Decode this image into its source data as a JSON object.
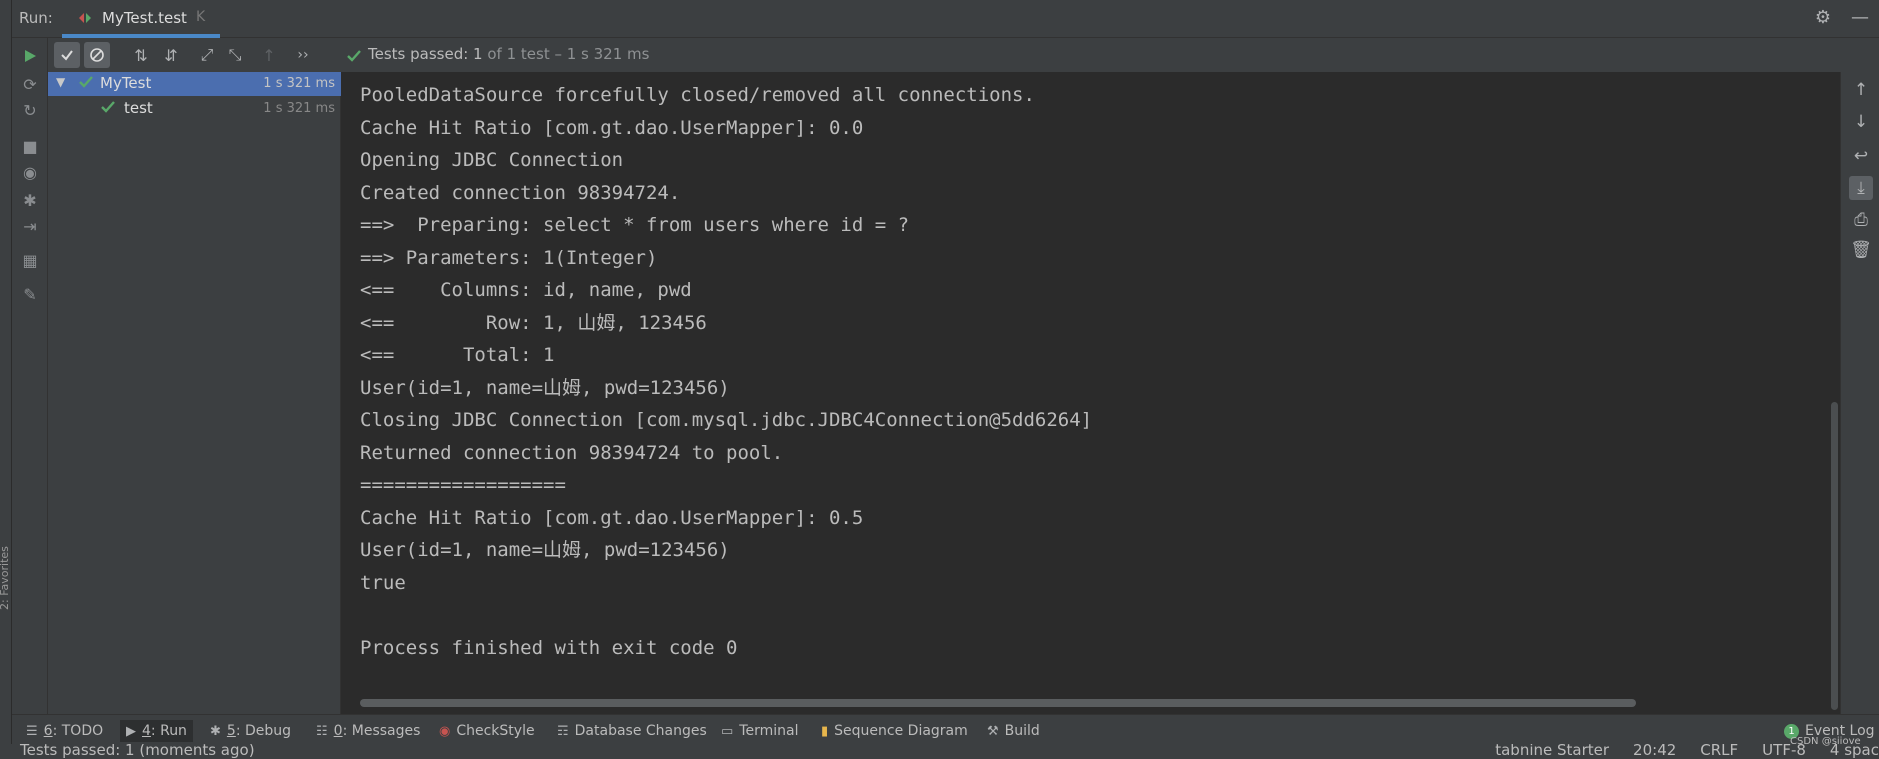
{
  "titlebar": {
    "run_label": "Run:",
    "tab_label": "MyTest.test",
    "tab_close": "K",
    "settings_icon": "gear-icon",
    "minimize_icon": "minimize-icon"
  },
  "toolbar": {
    "status_prefix": "Tests passed: ",
    "status_count": "1",
    "status_suffix": " of 1 test – 1 s 321 ms",
    "more_label": "››"
  },
  "tree": {
    "items": [
      {
        "name": "MyTest",
        "time": "1 s 321 ms",
        "status": "passed",
        "expanded": true,
        "selected": true
      },
      {
        "name": "test",
        "time": "1 s 321 ms",
        "status": "passed",
        "selected": false
      }
    ]
  },
  "console": {
    "lines": [
      "PooledDataSource forcefully closed/removed all connections.",
      "Cache Hit Ratio [com.gt.dao.UserMapper]: 0.0",
      "Opening JDBC Connection",
      "Created connection 98394724.",
      "==>  Preparing: select * from users where id = ?",
      "==> Parameters: 1(Integer)",
      "<==    Columns: id, name, pwd",
      "<==        Row: 1, 山姆, 123456",
      "<==      Total: 1",
      "User(id=1, name=山姆, pwd=123456)",
      "Closing JDBC Connection [com.mysql.jdbc.JDBC4Connection@5dd6264]",
      "Returned connection 98394724 to pool.",
      "==================",
      "Cache Hit Ratio [com.gt.dao.UserMapper]: 0.5",
      "User(id=1, name=山姆, pwd=123456)",
      "true",
      "",
      "Process finished with exit code 0"
    ]
  },
  "bottombar": {
    "items": [
      {
        "key": "6",
        "label": ": TODO"
      },
      {
        "key": "4",
        "label": ": Run"
      },
      {
        "key": "5",
        "label": ": Debug"
      },
      {
        "key": "0",
        "label": ": Messages"
      },
      {
        "key": "",
        "label": "CheckStyle"
      },
      {
        "key": "",
        "label": "Database Changes"
      },
      {
        "key": "",
        "label": "Terminal"
      },
      {
        "key": "",
        "label": "Sequence Diagram"
      },
      {
        "key": "",
        "label": "Build"
      }
    ],
    "event_log": "Event Log",
    "event_count": "1"
  },
  "statusbar": {
    "message": "Tests passed: 1 (moments ago)",
    "tabnine": "tabnine Starter",
    "position": "20:42",
    "line_sep": "CRLF",
    "encoding": "UTF-8",
    "indent": "4 spac",
    "watermark": "CSDN @siiove"
  },
  "sidebar_favorites": "2: Favorites",
  "colors": {
    "accent": "#4a88c7",
    "pass_green": "#59a869",
    "run_green": "#59a869",
    "selection": "#4b6eaf"
  }
}
